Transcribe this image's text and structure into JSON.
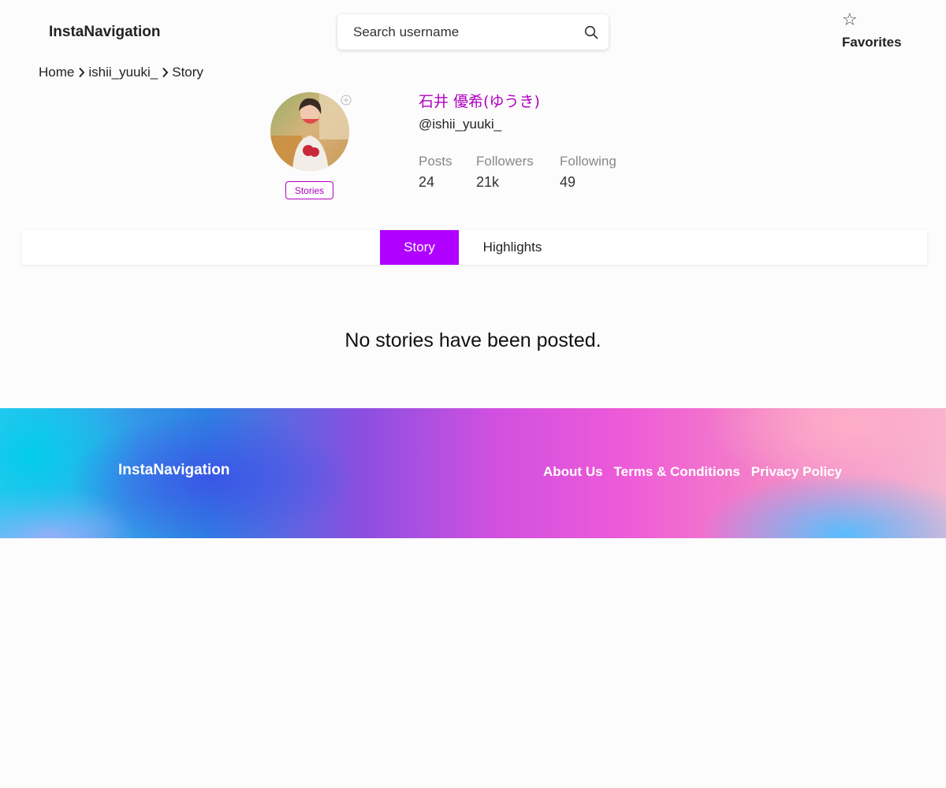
{
  "header": {
    "brand": "InstaNavigation",
    "search_placeholder": "Search username",
    "search_icon": "search-icon",
    "favorites_icon": "star-outline-icon",
    "favorites_label": "Favorites"
  },
  "breadcrumb": {
    "items": [
      "Home",
      "ishii_yuuki_",
      "Story"
    ],
    "separator_icon": "chevron-right-icon"
  },
  "profile": {
    "full_name": "石井 優希(ゆうき)",
    "username": "@ishii_yuuki_",
    "stories_button": "Stories",
    "stats": [
      {
        "label": "Posts",
        "value": "24"
      },
      {
        "label": "Followers",
        "value": "21k"
      },
      {
        "label": "Following",
        "value": "49"
      }
    ]
  },
  "tabs": [
    {
      "label": "Story",
      "active": true
    },
    {
      "label": "Highlights",
      "active": false
    }
  ],
  "content": {
    "empty_message": "No stories have been posted."
  },
  "footer": {
    "brand": "InstaNavigation",
    "links": [
      "About Us",
      "Terms & Conditions",
      "Privacy Policy"
    ]
  },
  "colors": {
    "accent": "#b000c0",
    "active_tab": "#b000ff",
    "background": "#fcfcfc"
  }
}
